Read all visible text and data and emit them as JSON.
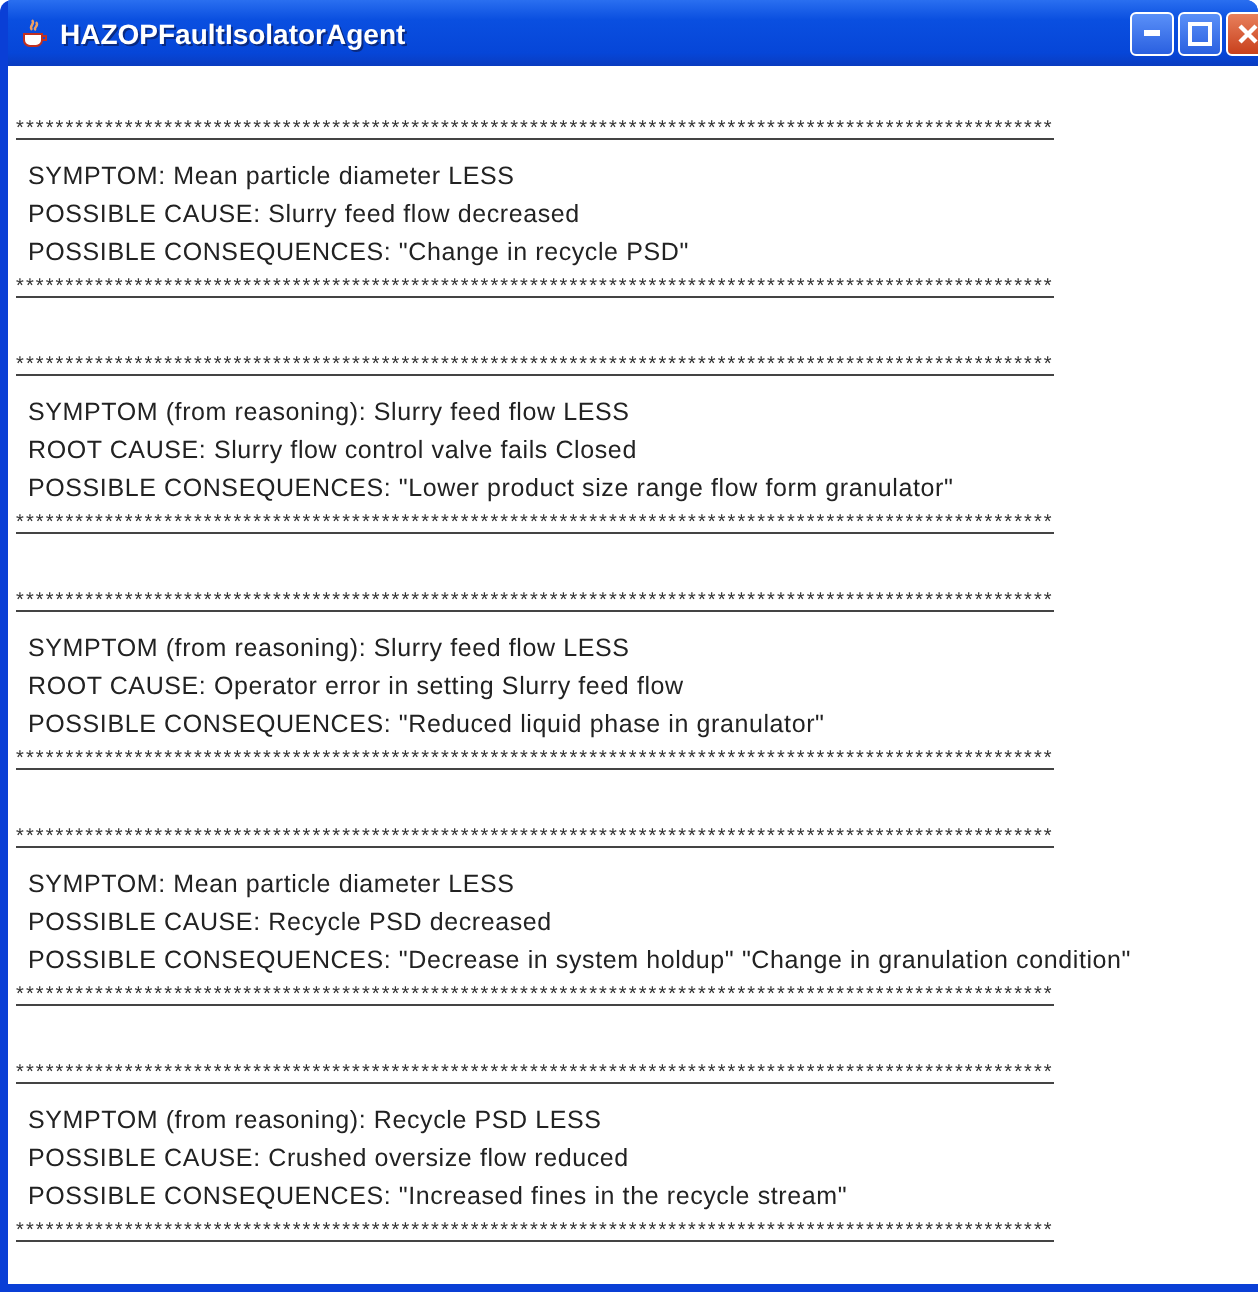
{
  "window": {
    "title": "HAZOPFaultIsolatorAgent"
  },
  "entries": [
    {
      "separator_above": "*********************************************************************************************************",
      "lines": [
        "SYMPTOM: Mean particle diameter LESS",
        "POSSIBLE CAUSE: Slurry feed flow decreased",
        "POSSIBLE CONSEQUENCES: \"Change in recycle PSD\""
      ],
      "separator_below": "*********************************************************************************************************"
    },
    {
      "separator_above": "*********************************************************************************************************",
      "lines": [
        "SYMPTOM (from reasoning): Slurry feed flow LESS",
        "ROOT CAUSE: Slurry flow control valve fails Closed",
        "POSSIBLE CONSEQUENCES: \"Lower product size range flow form granulator\""
      ],
      "separator_below": "*********************************************************************************************************"
    },
    {
      "separator_above": "*********************************************************************************************************",
      "lines": [
        "SYMPTOM (from reasoning): Slurry feed flow LESS",
        "ROOT CAUSE: Operator error in setting Slurry feed flow",
        "POSSIBLE CONSEQUENCES: \"Reduced liquid phase in granulator\""
      ],
      "separator_below": "*********************************************************************************************************"
    },
    {
      "separator_above": "*********************************************************************************************************",
      "lines": [
        "SYMPTOM: Mean particle diameter LESS",
        "POSSIBLE CAUSE: Recycle PSD decreased",
        "POSSIBLE CONSEQUENCES: \"Decrease in system holdup\" \"Change in granulation condition\""
      ],
      "separator_below": "*********************************************************************************************************"
    },
    {
      "separator_above": "*********************************************************************************************************",
      "lines": [
        "SYMPTOM (from reasoning): Recycle PSD LESS",
        "POSSIBLE CAUSE: Crushed oversize flow reduced",
        "POSSIBLE CONSEQUENCES: \"Increased fines in the recycle stream\""
      ],
      "separator_below": "*********************************************************************************************************"
    }
  ]
}
